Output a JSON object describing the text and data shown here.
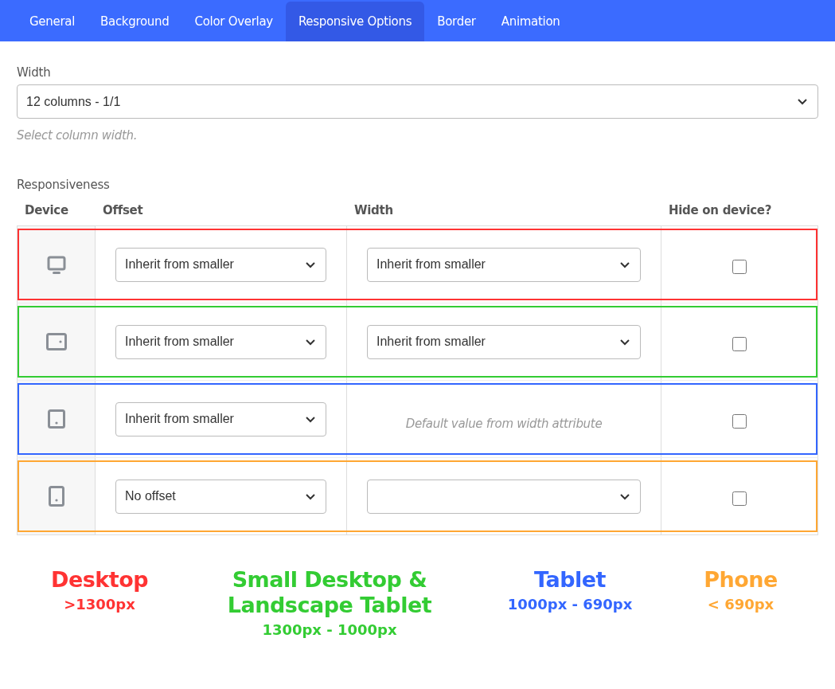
{
  "tabs": [
    {
      "label": "General",
      "selected": false
    },
    {
      "label": "Background",
      "selected": false
    },
    {
      "label": "Color Overlay",
      "selected": false
    },
    {
      "label": "Responsive Options",
      "selected": true
    },
    {
      "label": "Border",
      "selected": false
    },
    {
      "label": "Animation",
      "selected": false
    }
  ],
  "width_field": {
    "label": "Width",
    "value": "12 columns - 1/1",
    "help": "Select column width."
  },
  "responsiveness": {
    "label": "Responsiveness",
    "columns": [
      "Device",
      "Offset",
      "Width",
      "Hide on device?"
    ],
    "rows": [
      {
        "kind": "desktop",
        "color": "#ff3333",
        "offset": "Inherit from smaller",
        "width": {
          "kind": "select",
          "value": "Inherit from smaller"
        },
        "hidden": false
      },
      {
        "kind": "landscape-tablet",
        "color": "#33cc33",
        "offset": "Inherit from smaller",
        "width": {
          "kind": "select",
          "value": "Inherit from smaller"
        },
        "hidden": false
      },
      {
        "kind": "tablet",
        "color": "#3366ff",
        "offset": "Inherit from smaller",
        "width": {
          "kind": "note",
          "text": "Default value from width attribute"
        },
        "hidden": false
      },
      {
        "kind": "phone",
        "color": "#ffa733",
        "offset": "No offset",
        "width": {
          "kind": "select"
        },
        "hidden": false
      }
    ]
  },
  "legend": [
    {
      "title": "Desktop",
      "range": ">1300px",
      "color": "#ff3333"
    },
    {
      "title": "Small Desktop & Landscape Tablet",
      "range": "1300px - 1000px",
      "color": "#33cc33"
    },
    {
      "title": "Tablet",
      "range": "1000px - 690px",
      "color": "#3366ff"
    },
    {
      "title": "Phone",
      "range": "< 690px",
      "color": "#ffa733"
    }
  ]
}
